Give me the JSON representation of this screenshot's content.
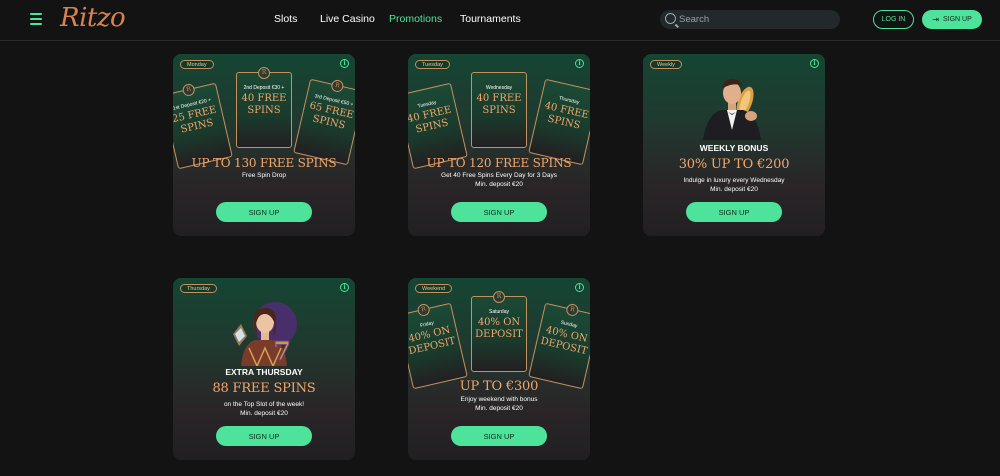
{
  "header": {
    "logo": "Ritzo",
    "nav": [
      {
        "label": "Slots",
        "active": false
      },
      {
        "label": "Live Casino",
        "active": false
      },
      {
        "label": "Promotions",
        "active": true
      },
      {
        "label": "Tournaments",
        "active": false
      }
    ],
    "search_placeholder": "Search",
    "login_label": "LOG IN",
    "signup_label": "SIGN UP"
  },
  "colors": {
    "accent": "#4de39a",
    "gold": "#f3a66b",
    "border_gold": "#c4915f",
    "background": "#131313"
  },
  "cards": [
    {
      "tag": "Monday",
      "title": "UP TO 130 FREE SPINS",
      "lines": [
        "Free Spin Drop"
      ],
      "button": "SIGN UP",
      "mini": [
        {
          "day": "1st Deposit €20 +",
          "value": "25 FREE SPINS"
        },
        {
          "day": "2nd Deposit €30 +",
          "value": "40 FREE SPINS"
        },
        {
          "day": "3rd Deposit €50 +",
          "value": "65 FREE SPINS"
        }
      ]
    },
    {
      "tag": "Tuesday",
      "title": "UP TO 120 FREE SPINS",
      "lines": [
        "Get 40 Free Spins Every Day for 3 Days",
        "Min. deposit €20"
      ],
      "button": "SIGN UP",
      "mini": [
        {
          "day": "Tuesday",
          "value": "40 FREE SPINS"
        },
        {
          "day": "Wednesday",
          "value": "40 FREE SPINS"
        },
        {
          "day": "Thursday",
          "value": "40 FREE SPINS"
        }
      ]
    },
    {
      "tag": "Weekly",
      "heading": "WEEKLY BONUS",
      "title": "30% UP TO €200",
      "lines": [
        "Indulge in luxury every Wednesday",
        "Min. deposit €20"
      ],
      "button": "SIGN UP"
    },
    {
      "tag": "Thursday",
      "heading": "EXTRA THURSDAY",
      "title": "88 FREE SPINS",
      "lines": [
        "on the Top Slot of the week!",
        "Min. deposit €20"
      ],
      "button": "SIGN UP"
    },
    {
      "tag": "Weekend",
      "title": "UP TO €300",
      "lines": [
        "Enjoy weekend with bonus",
        "Min. deposit €20"
      ],
      "button": "SIGN UP",
      "mini": [
        {
          "day": "Friday",
          "value": "40% ON DEPOSIT"
        },
        {
          "day": "Saturday",
          "value": "40% ON DEPOSIT"
        },
        {
          "day": "Sunday",
          "value": "40% ON DEPOSIT"
        }
      ]
    }
  ]
}
